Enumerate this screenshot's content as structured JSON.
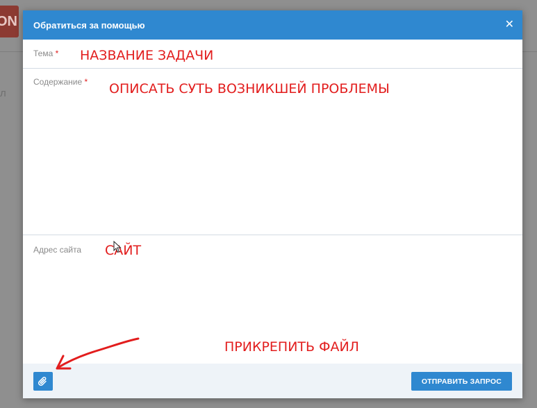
{
  "background": {
    "logo_text": "ON"
  },
  "dialog": {
    "title": "Обратиться за помощью",
    "close_glyph": "✕",
    "fields": {
      "subject": {
        "label": "Тема",
        "required_mark": "*",
        "value": ""
      },
      "content": {
        "label": "Содержание",
        "required_mark": "*",
        "value": ""
      },
      "site": {
        "label": "Адрес сайта",
        "value": ""
      }
    },
    "footer": {
      "attach_icon": "paperclip-icon",
      "send_label": "ОТПРАВИТЬ ЗАПРОС"
    }
  },
  "annotations": {
    "subject": "НАЗВАНИЕ ЗАДАЧИ",
    "content": "ОПИСАТЬ СУТЬ ВОЗНИКШЕЙ ПРОБЛЕМЫ",
    "site": "САЙТ",
    "attach": "ПРИКРЕПИТЬ ФАЙЛ"
  },
  "colors": {
    "accent": "#2f88d0",
    "annotation": "#e21d1d",
    "required": "#e02020",
    "footer_bg": "#eef3f8"
  }
}
